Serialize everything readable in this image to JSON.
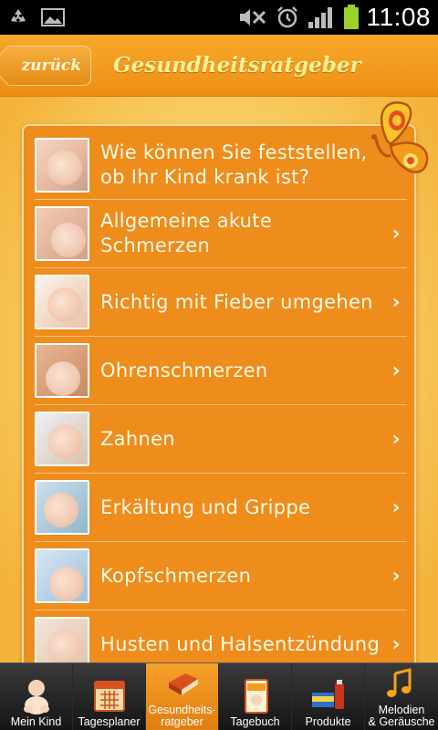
{
  "status_bar": {
    "time": "11:08",
    "left_icons": [
      "recycle-icon",
      "image-icon"
    ],
    "right_icons": [
      "mute-icon",
      "alarm-icon",
      "signal-icon",
      "battery-icon"
    ]
  },
  "header": {
    "back_label": "zurück",
    "title": "Gesundheitsratgeber"
  },
  "list": {
    "items": [
      {
        "label": "Wie können Sie feststellen,\nob Ihr Kind krank ist?",
        "has_chevron": false
      },
      {
        "label": "Allgemeine akute Schmerzen",
        "has_chevron": true
      },
      {
        "label": "Richtig mit Fieber umgehen",
        "has_chevron": true
      },
      {
        "label": "Ohrenschmerzen",
        "has_chevron": true
      },
      {
        "label": "Zahnen",
        "has_chevron": true
      },
      {
        "label": "Erkältung und Grippe",
        "has_chevron": true
      },
      {
        "label": "Kopfschmerzen",
        "has_chevron": true
      },
      {
        "label": "Husten und Halsentzündung",
        "has_chevron": true
      }
    ]
  },
  "tabs": [
    {
      "label": "Mein Kind",
      "icon": "baby-icon",
      "active": false
    },
    {
      "label": "Tagesplaner",
      "icon": "calendar-icon",
      "active": false
    },
    {
      "label": "Gesundheits-\nratgeber",
      "icon": "book-icon",
      "active": true
    },
    {
      "label": "Tagebuch",
      "icon": "diary-icon",
      "active": false
    },
    {
      "label": "Produkte",
      "icon": "products-icon",
      "active": false
    },
    {
      "label": "Melodien\n& Geräusche",
      "icon": "music-note-icon",
      "active": false
    }
  ],
  "colors": {
    "accent": "#ee8c1c",
    "title_text": "#fff39a",
    "active_tab": "#f7a12a"
  }
}
